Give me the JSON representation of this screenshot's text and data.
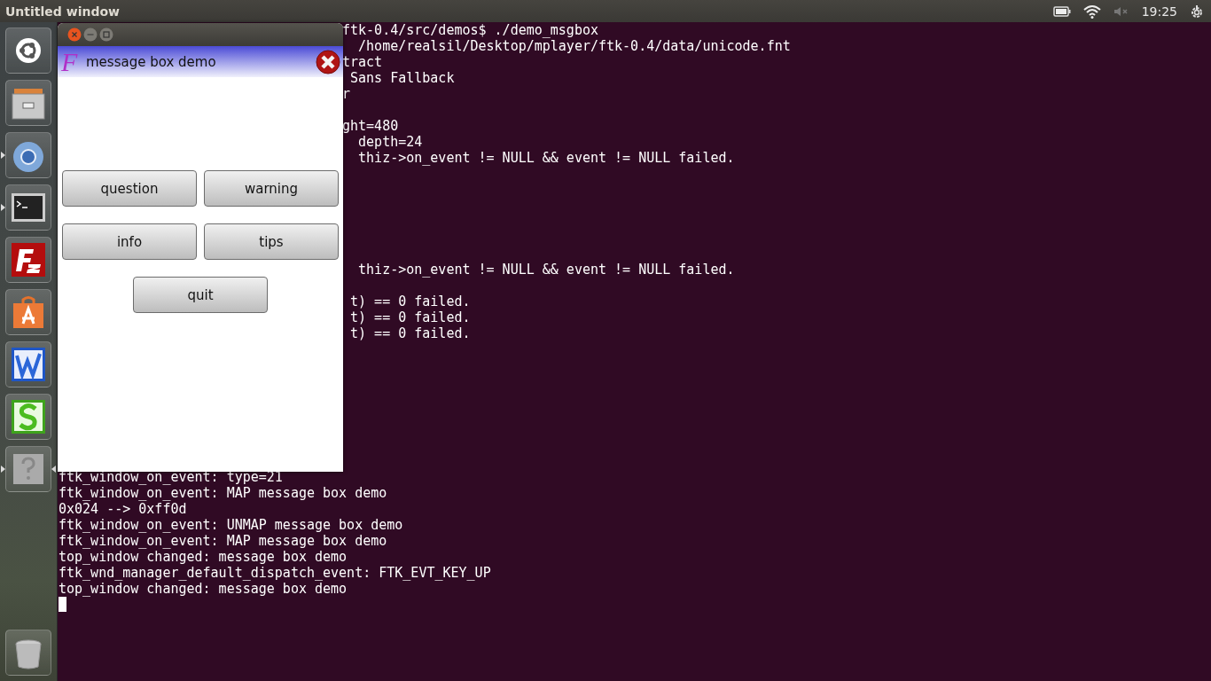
{
  "top_bar": {
    "title": "Untitled window",
    "clock": "19:25"
  },
  "launcher": {
    "items": [
      {
        "kind": "ubuntu",
        "running": false
      },
      {
        "kind": "files",
        "running": false
      },
      {
        "kind": "browser",
        "running": true
      },
      {
        "kind": "terminal",
        "running": true
      },
      {
        "kind": "filezilla",
        "running": false
      },
      {
        "kind": "store",
        "running": false
      },
      {
        "kind": "writer",
        "running": false
      },
      {
        "kind": "spreadsheet",
        "running": false
      },
      {
        "kind": "help",
        "running": true
      }
    ],
    "trash": {
      "kind": "trash"
    }
  },
  "terminal": {
    "lines": [
      {
        "kind": "clipped",
        "text": "ftk-0.4/src/demos$ ./demo_msgbox"
      },
      {
        "kind": "clipped",
        "text": "  /home/realsil/Desktop/mplayer/ftk-0.4/data/unicode.fnt"
      },
      {
        "kind": "clipped",
        "text": "tract"
      },
      {
        "kind": "clipped",
        "text": " Sans Fallback"
      },
      {
        "kind": "clipped",
        "text": "r"
      },
      {
        "kind": "blank"
      },
      {
        "kind": "clipped",
        "text": "ght=480"
      },
      {
        "kind": "clipped",
        "text": "  depth=24"
      },
      {
        "kind": "clipped",
        "text": "  thiz->on_event != NULL && event != NULL failed."
      },
      {
        "kind": "blank"
      },
      {
        "kind": "blank"
      },
      {
        "kind": "blank"
      },
      {
        "kind": "blank"
      },
      {
        "kind": "blank"
      },
      {
        "kind": "blank"
      },
      {
        "kind": "clipped",
        "text": "  thiz->on_event != NULL && event != NULL failed."
      },
      {
        "kind": "blank"
      },
      {
        "kind": "clipped",
        "text": " t) == 0 failed."
      },
      {
        "kind": "clipped",
        "text": " t) == 0 failed."
      },
      {
        "kind": "clipped",
        "text": " t) == 0 failed."
      },
      {
        "kind": "blank"
      },
      {
        "kind": "blank"
      },
      {
        "kind": "blank"
      },
      {
        "kind": "blank"
      },
      {
        "kind": "blank"
      },
      {
        "kind": "blank"
      },
      {
        "kind": "blank"
      },
      {
        "kind": "blank"
      },
      {
        "kind": "line",
        "text": "ftk_window_on_event: type=21"
      },
      {
        "kind": "line",
        "text": "ftk_window_on_event: MAP message box demo"
      },
      {
        "kind": "line",
        "text": "0x024 --> 0xff0d"
      },
      {
        "kind": "line",
        "text": "ftk_window_on_event: UNMAP message box demo"
      },
      {
        "kind": "line",
        "text": "ftk_window_on_event: MAP message box demo"
      },
      {
        "kind": "line",
        "text": "top_window changed: message box demo"
      },
      {
        "kind": "line",
        "text": "ftk_wnd_manager_default_dispatch_event: FTK_EVT_KEY_UP"
      },
      {
        "kind": "line",
        "text": "top_window changed: message box demo"
      },
      {
        "kind": "cursor"
      }
    ]
  },
  "message_window": {
    "logo_letter": "F",
    "title": "message box demo",
    "buttons": [
      {
        "label": "question"
      },
      {
        "label": "warning"
      },
      {
        "label": "info"
      },
      {
        "label": "tips"
      },
      {
        "label": "quit"
      }
    ]
  }
}
